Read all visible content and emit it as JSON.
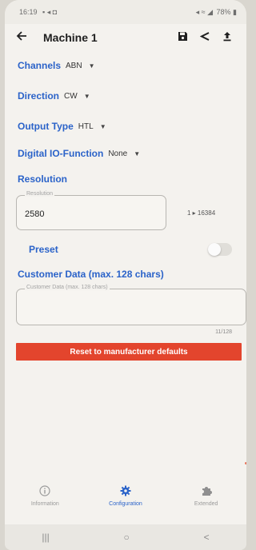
{
  "status": {
    "time": "16:19",
    "left_icons": "▪ ◂ ◘",
    "right_icons": "◂ ≈ ◢",
    "battery": "78%"
  },
  "appbar": {
    "title": "Machine 1",
    "back_icon": "arrow-left-icon",
    "save_icon": "save-icon",
    "share_icon": "share-icon",
    "upload_icon": "upload-icon"
  },
  "settings": {
    "channels": {
      "label": "Channels",
      "value": "ABN"
    },
    "direction": {
      "label": "Direction",
      "value": "CW"
    },
    "output_type": {
      "label": "Output Type",
      "value": "HTL"
    },
    "digital_io": {
      "label": "Digital IO-Function",
      "value": "None"
    }
  },
  "resolution": {
    "heading": "Resolution",
    "field_label": "Resolution",
    "value": "2580",
    "range": "1 ▸ 16384"
  },
  "preset": {
    "label": "Preset",
    "enabled": false
  },
  "customer_data": {
    "heading": "Customer Data (max. 128 chars)",
    "field_label": "Customer Data (max. 128 chars)",
    "value": "",
    "counter": "11/128"
  },
  "reset_button": {
    "label": "Reset to manufacturer defaults",
    "color": "#e3452d"
  },
  "bottom_nav": {
    "items": [
      {
        "label": "Information",
        "icon": "info-icon",
        "active": false
      },
      {
        "label": "Configuration",
        "icon": "gear-icon",
        "active": true
      },
      {
        "label": "Extended",
        "icon": "puzzle-icon",
        "active": false
      }
    ],
    "active_color": "#2b63c9",
    "inactive_color": "#9a9a9a"
  },
  "system_nav": {
    "recents": "|||",
    "home": "○",
    "back": "<"
  },
  "colors": {
    "accent": "#2b63c9",
    "background": "#f4f2ee"
  }
}
